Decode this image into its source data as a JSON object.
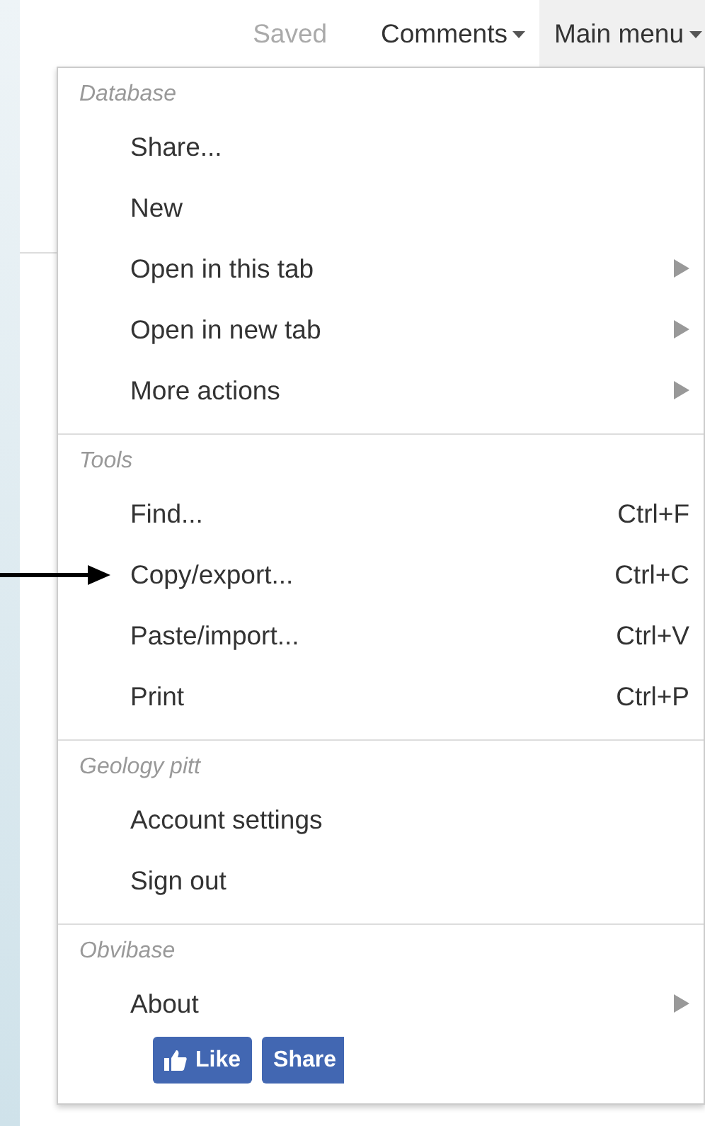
{
  "topbar": {
    "status": "Saved",
    "menus": [
      {
        "label": "Comments",
        "open": false
      },
      {
        "label": "Main menu",
        "open": true
      }
    ]
  },
  "main_menu": {
    "sections": [
      {
        "header": "Database",
        "items": [
          {
            "label": "Share...",
            "has_submenu": false
          },
          {
            "label": "New",
            "has_submenu": false
          },
          {
            "label": "Open in this tab",
            "has_submenu": true
          },
          {
            "label": "Open in new tab",
            "has_submenu": true
          },
          {
            "label": "More actions",
            "has_submenu": true
          }
        ]
      },
      {
        "header": "Tools",
        "items": [
          {
            "label": "Find...",
            "shortcut": "Ctrl+F",
            "has_submenu": false
          },
          {
            "label": "Copy/export...",
            "shortcut": "Ctrl+C",
            "has_submenu": false
          },
          {
            "label": "Paste/import...",
            "shortcut": "Ctrl+V",
            "has_submenu": false
          },
          {
            "label": "Print",
            "shortcut": "Ctrl+P",
            "has_submenu": false
          }
        ]
      },
      {
        "header": "Geology pitt",
        "items": [
          {
            "label": "Account settings",
            "has_submenu": false
          },
          {
            "label": "Sign out",
            "has_submenu": false
          }
        ]
      },
      {
        "header": "Obvibase",
        "items": [
          {
            "label": "About",
            "has_submenu": true
          }
        ]
      }
    ],
    "social_buttons": [
      {
        "kind": "like",
        "label": "Like"
      },
      {
        "kind": "share",
        "label": "Share"
      }
    ]
  }
}
